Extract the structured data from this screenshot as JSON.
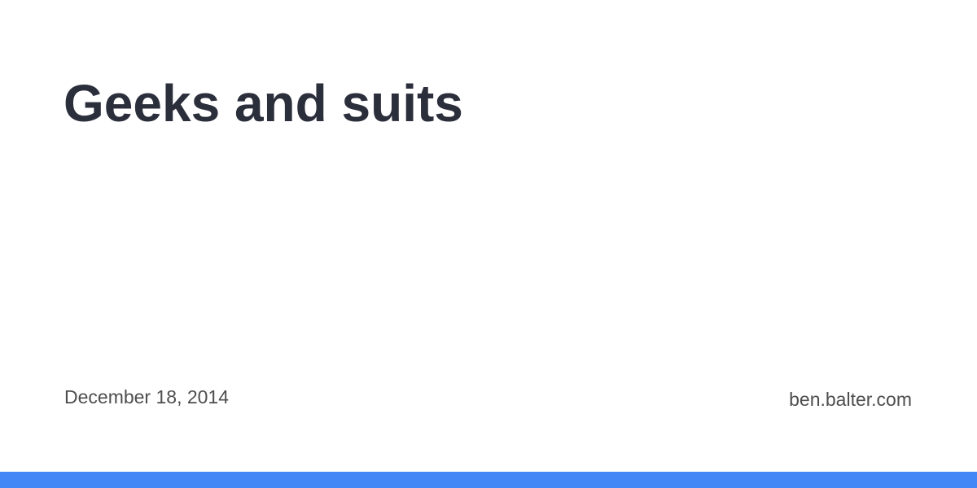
{
  "card": {
    "title": "Geeks and suits",
    "date": "December 18, 2014",
    "domain": "ben.balter.com"
  },
  "colors": {
    "background": "#ffffff",
    "title_text": "#2b2e3b",
    "meta_text": "#4e4e4e",
    "accent_bar": "#4287f5"
  }
}
